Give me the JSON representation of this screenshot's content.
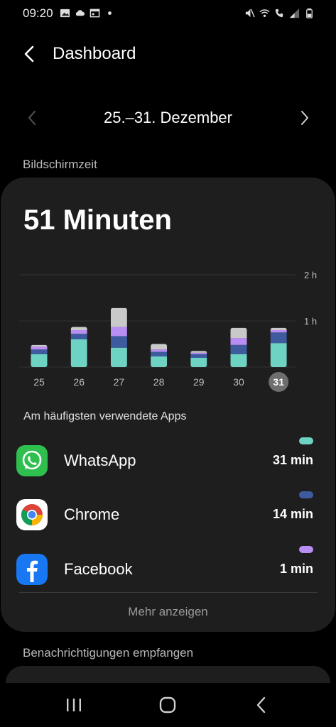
{
  "status_bar": {
    "time": "09:20",
    "left_icons": [
      "image-icon",
      "cloud-icon",
      "calendar-icon",
      "dot-icon"
    ],
    "right_icons": [
      "mute-icon",
      "wifi-icon",
      "wifi-call-icon",
      "signal-icon",
      "battery-icon"
    ]
  },
  "header": {
    "title": "Dashboard"
  },
  "range": {
    "label": "25.–31. Dezember"
  },
  "screen_time": {
    "section_label": "Bildschirmzeit",
    "total": "51 Minuten"
  },
  "chart_data": {
    "type": "bar",
    "stacked": true,
    "categories": [
      "25",
      "26",
      "27",
      "28",
      "29",
      "30",
      "31"
    ],
    "selected_category": "31",
    "y_unit": "hours",
    "ylim": [
      0,
      2
    ],
    "y_ticks": [
      {
        "value": 1,
        "label": "1 h"
      },
      {
        "value": 2,
        "label": "2 h"
      }
    ],
    "grid": true,
    "series": [
      {
        "name": "WhatsApp",
        "color": "#6fd3c3",
        "values": [
          0.28,
          0.6,
          0.42,
          0.23,
          0.2,
          0.28,
          0.52
        ]
      },
      {
        "name": "Chrome",
        "color": "#3f5ba0",
        "values": [
          0.1,
          0.12,
          0.25,
          0.1,
          0.08,
          0.2,
          0.23
        ]
      },
      {
        "name": "Facebook",
        "color": "#b88ef2",
        "values": [
          0.06,
          0.08,
          0.2,
          0.05,
          0.03,
          0.15,
          0.05
        ]
      },
      {
        "color": "#c9c9c9",
        "values": [
          0.04,
          0.07,
          0.41,
          0.12,
          0.04,
          0.22,
          0.05
        ]
      }
    ]
  },
  "apps": {
    "heading": "Am häufigsten verwendete Apps",
    "items": [
      {
        "name": "WhatsApp",
        "time": "31 min",
        "color": "#6fd3c3",
        "icon": "whatsapp-icon"
      },
      {
        "name": "Chrome",
        "time": "14 min",
        "color": "#3f5ba0",
        "icon": "chrome-icon"
      },
      {
        "name": "Facebook",
        "time": "1 min",
        "color": "#b88ef2",
        "icon": "facebook-icon"
      }
    ],
    "more_label": "Mehr anzeigen"
  },
  "notifications": {
    "section_label": "Benachrichtigungen empfangen"
  },
  "nav_bar": {
    "buttons": [
      "recents-icon",
      "home-icon",
      "back-icon"
    ]
  }
}
